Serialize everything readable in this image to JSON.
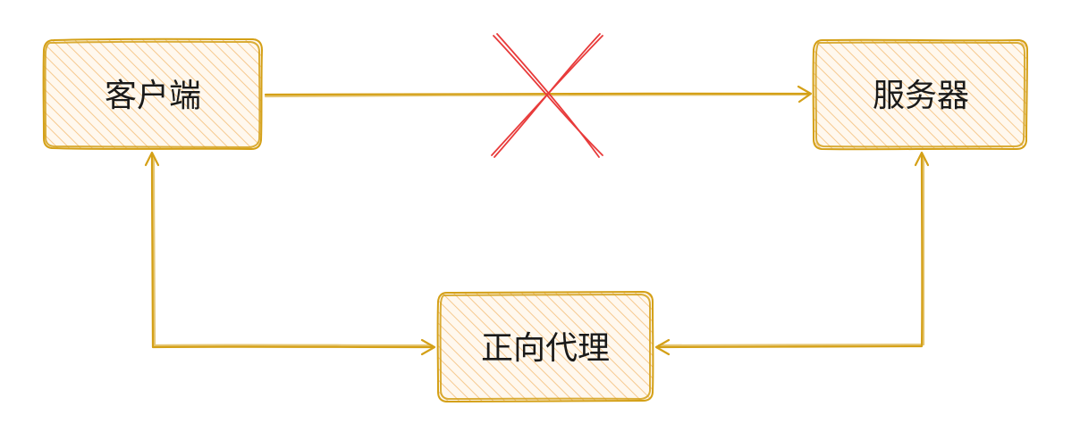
{
  "diagram": {
    "nodes": {
      "client": {
        "label": "客户端"
      },
      "server": {
        "label": "服务器"
      },
      "proxy": {
        "label": "正向代理"
      }
    },
    "edges": [
      {
        "from": "client",
        "to": "server",
        "blocked": true
      },
      {
        "from": "client",
        "to": "proxy",
        "bidirectional": true
      },
      {
        "from": "server",
        "to": "proxy",
        "bidirectional": true
      }
    ],
    "colors": {
      "box_stroke": "#d4a017",
      "box_fill": "#fde9cc",
      "edge": "#d4a017",
      "blocked_marker": "#e83b3b"
    }
  }
}
